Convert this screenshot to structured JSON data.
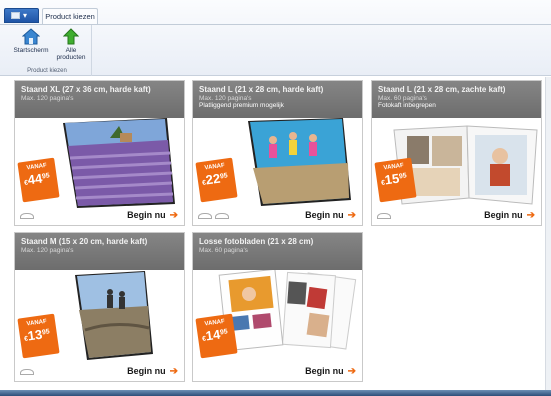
{
  "ribbon": {
    "app_button_label": "",
    "active_tab": "Product kiezen",
    "home_label": "Startscherm",
    "all_label_1": "Alle",
    "all_label_2": "producten",
    "group_label": "Product kiezen"
  },
  "colors": {
    "accent": "#ee6a12",
    "header": "#787878"
  },
  "cards": [
    {
      "title": "Staand XL (27 x 36 cm, harde kaft)",
      "sub": "Max. 120 pagina's",
      "note": "",
      "vanaf": "VANAF",
      "currency": "€",
      "amount": "44",
      "cents": "95",
      "cta": "Begin nu"
    },
    {
      "title": "Staand L (21 x 28 cm, harde kaft)",
      "sub": "Max. 120 pagina's",
      "note": "Platliggend premium mogelijk",
      "vanaf": "VANAF",
      "currency": "€",
      "amount": "22",
      "cents": "95",
      "cta": "Begin nu"
    },
    {
      "title": "Staand L (21 x 28 cm, zachte kaft)",
      "sub": "Max. 60 pagina's",
      "note": "Fotokaft inbegrepen",
      "vanaf": "VANAF",
      "currency": "€",
      "amount": "15",
      "cents": "95",
      "cta": "Begin nu"
    },
    {
      "title": "Staand M (15 x 20 cm, harde kaft)",
      "sub": "Max. 120 pagina's",
      "note": "",
      "vanaf": "VANAF",
      "currency": "€",
      "amount": "13",
      "cents": "95",
      "cta": "Begin nu"
    },
    {
      "title": "Losse fotobladen (21 x 28 cm)",
      "sub": "Max. 60 pagina's",
      "note": "",
      "vanaf": "VANAF",
      "currency": "€",
      "amount": "14",
      "cents": "95",
      "cta": "Begin nu"
    }
  ]
}
